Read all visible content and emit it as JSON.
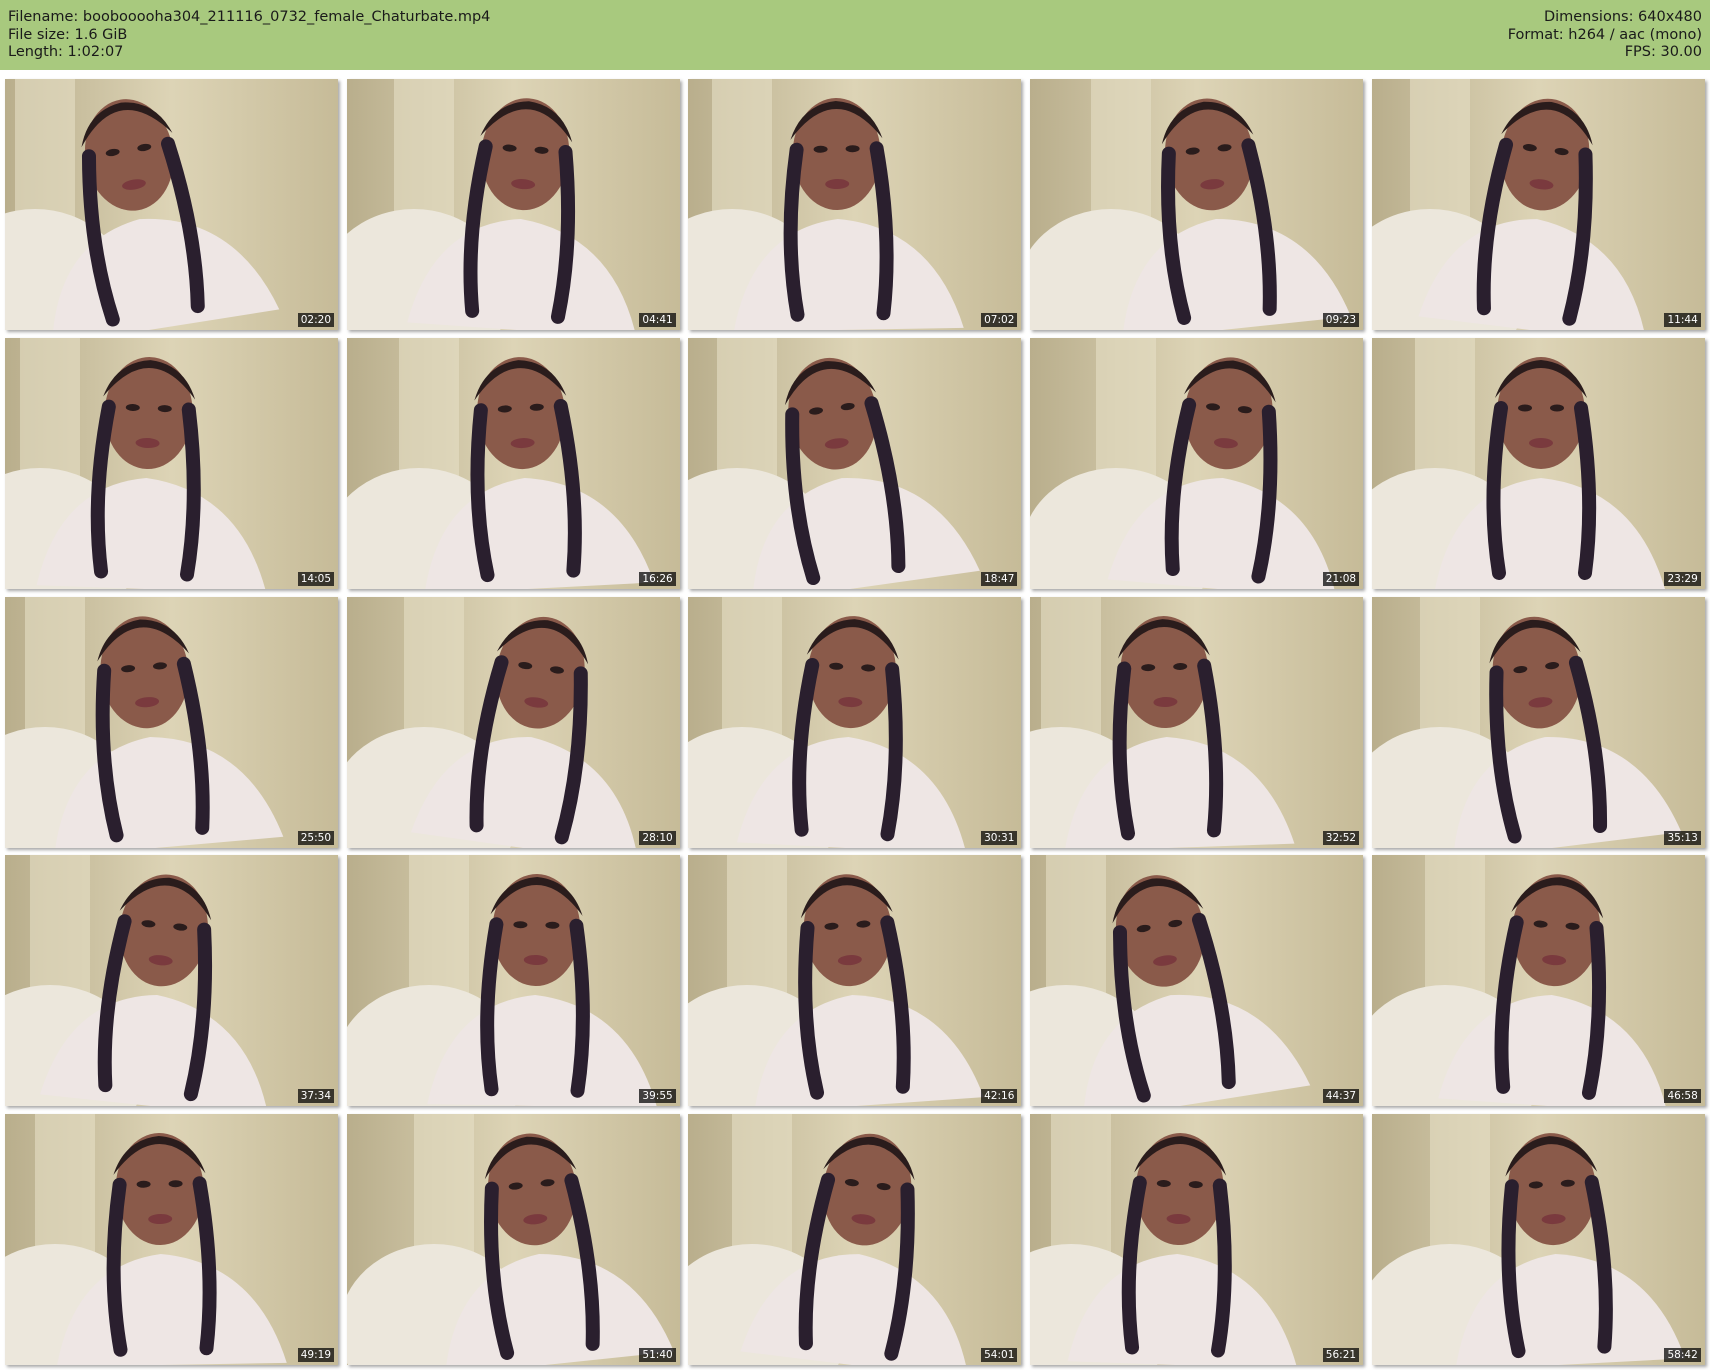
{
  "header": {
    "filename_line": "Filename: boobooooha304_211116_0732_female_Chaturbate.mp4",
    "filesize_line": "File size: 1.6 GiB",
    "length_line": "Length: 1:02:07",
    "dimensions_line": "Dimensions: 640x480",
    "format_line": "Format: h264 / aac (mono)",
    "fps_line": "FPS: 30.00"
  },
  "colors": {
    "header_bg": "#a8c97e",
    "page_bg": "#ffffff",
    "timestamp_bg": "#000000",
    "timestamp_fg": "#ffffff"
  },
  "thumbnails": [
    {
      "timestamp": "02:20"
    },
    {
      "timestamp": "04:41"
    },
    {
      "timestamp": "07:02"
    },
    {
      "timestamp": "09:23"
    },
    {
      "timestamp": "11:44"
    },
    {
      "timestamp": "14:05"
    },
    {
      "timestamp": "16:26"
    },
    {
      "timestamp": "18:47"
    },
    {
      "timestamp": "21:08"
    },
    {
      "timestamp": "23:29"
    },
    {
      "timestamp": "25:50"
    },
    {
      "timestamp": "28:10"
    },
    {
      "timestamp": "30:31"
    },
    {
      "timestamp": "32:52"
    },
    {
      "timestamp": "35:13"
    },
    {
      "timestamp": "37:34"
    },
    {
      "timestamp": "39:55"
    },
    {
      "timestamp": "42:16"
    },
    {
      "timestamp": "44:37"
    },
    {
      "timestamp": "46:58"
    },
    {
      "timestamp": "49:19"
    },
    {
      "timestamp": "51:40"
    },
    {
      "timestamp": "54:01"
    },
    {
      "timestamp": "56:21"
    },
    {
      "timestamp": "58:42"
    }
  ]
}
